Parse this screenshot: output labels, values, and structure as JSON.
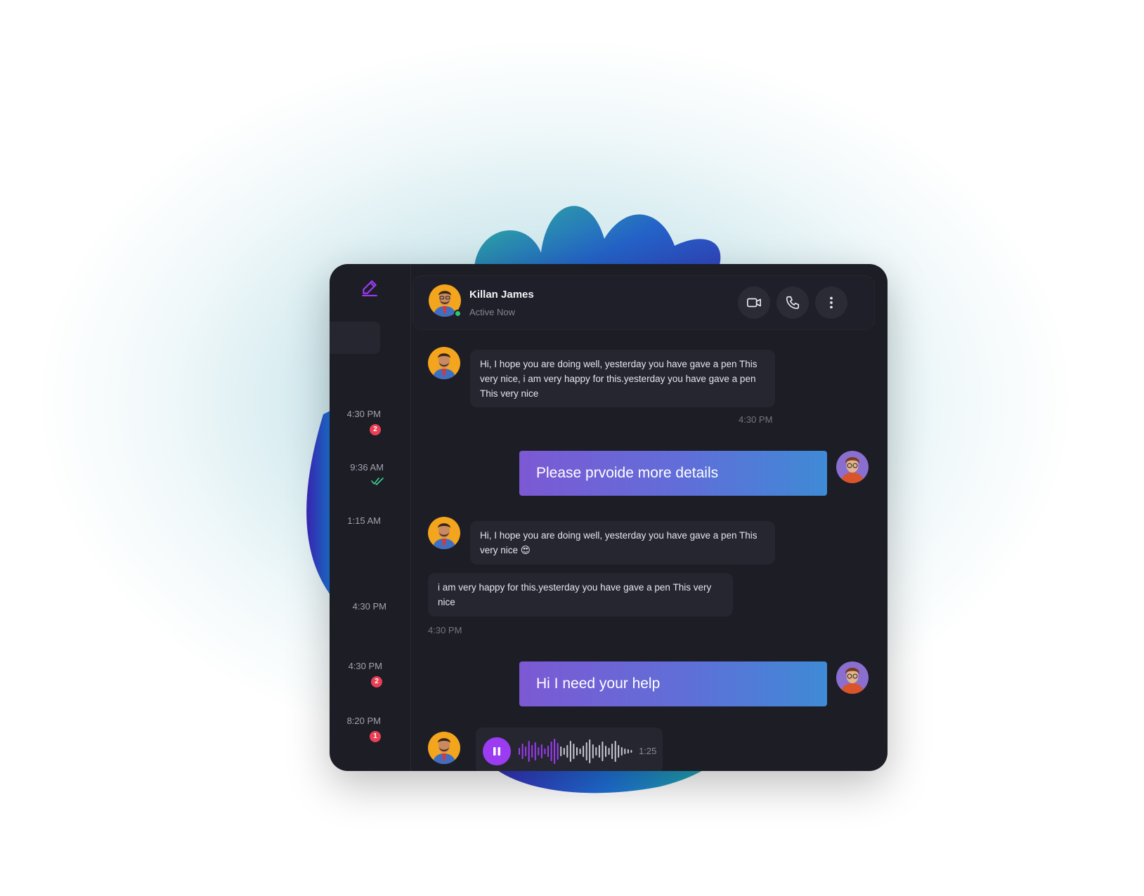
{
  "sidebar": {
    "items": [
      {
        "time": "4:30 PM",
        "badge": "2"
      },
      {
        "time": "9:36 AM",
        "read": true
      },
      {
        "time": "1:15 AM"
      },
      {
        "time": "4:30 PM"
      },
      {
        "time": "4:30 PM",
        "badge": "2"
      },
      {
        "time": "8:20 PM",
        "badge": "1"
      }
    ]
  },
  "header": {
    "name": "Killan James",
    "status": "Active Now",
    "actions": [
      "video-call",
      "voice-call",
      "more-options"
    ]
  },
  "messages": [
    {
      "type": "incoming",
      "text": "Hi, I hope you are doing well, yesterday you have gave a pen This very nice, i am very happy for this.yesterday you have gave a pen This very nice",
      "time": "4:30 PM"
    },
    {
      "type": "outgoing",
      "text": "Please prvoide more details"
    },
    {
      "type": "incoming",
      "text": "Hi, I hope you are doing well, yesterday you have gave a pen This very nice 😍"
    },
    {
      "type": "incoming",
      "text": " i am very happy for this.yesterday you have gave a pen This very nice",
      "time": "4:30 PM"
    },
    {
      "type": "outgoing",
      "text": "Hi I need your help"
    },
    {
      "type": "voice",
      "duration": "1:25",
      "progress": 0.35
    }
  ],
  "colors": {
    "accent": "#9b3cf3",
    "badge": "#ea3f55",
    "online": "#32c46e",
    "outgoing_start": "#7c59d4",
    "outgoing_end": "#3f8ad6"
  }
}
